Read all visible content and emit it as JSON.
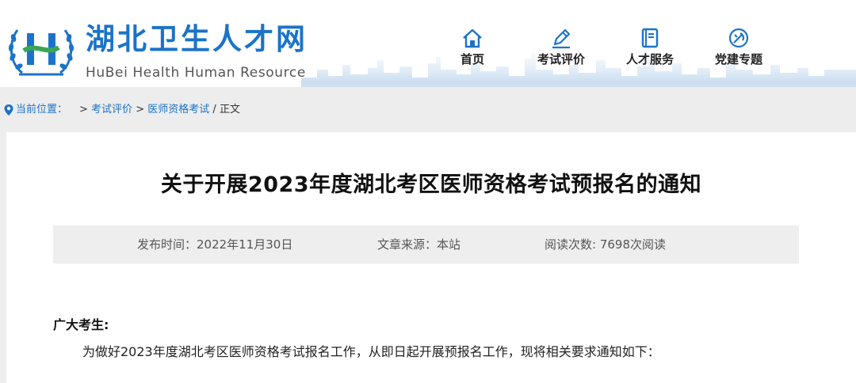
{
  "site": {
    "title": "湖北卫生人才网",
    "subtitle": "HuBei  Health Human Resource",
    "brand_color": "#1b73c9"
  },
  "nav": [
    {
      "label": "首页",
      "icon": "home-icon"
    },
    {
      "label": "考试评价",
      "icon": "pen-icon"
    },
    {
      "label": "人才服务",
      "icon": "book-icon"
    },
    {
      "label": "党建专题",
      "icon": "party-emblem-icon"
    }
  ],
  "breadcrumb": {
    "label": "当前位置：",
    "sep": ">",
    "items": [
      "考试评价",
      "医师资格考试"
    ],
    "current": "正文"
  },
  "article": {
    "title": "关于开展2023年度湖北考区医师资格考试预报名的通知",
    "meta": {
      "publish_time": "发布时间：2022年11月30日",
      "source": "文章来源：本站",
      "views": "阅读次数:   7698次阅读"
    },
    "greeting": "广大考生:",
    "paragraph": "为做好2023年度湖北考区医师资格考试报名工作，从即日起开展预报名工作，现将相关要求通知如下："
  }
}
